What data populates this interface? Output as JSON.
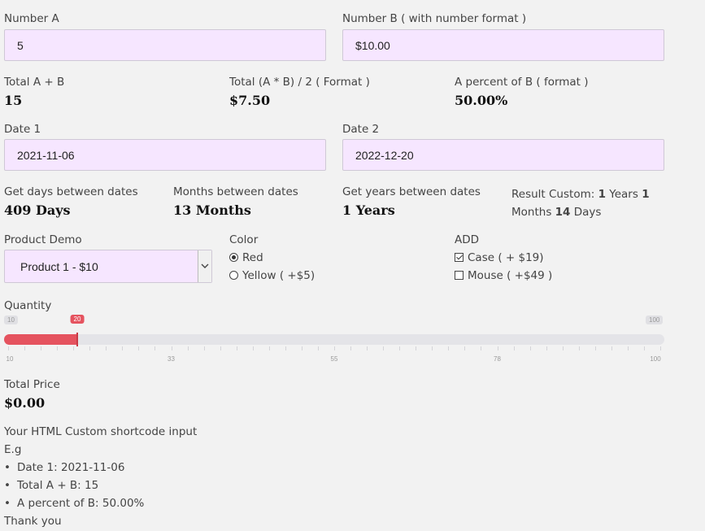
{
  "number_a": {
    "label": "Number A",
    "value": "5"
  },
  "number_b": {
    "label": "Number B ( with number format )",
    "value": "$10.00"
  },
  "totals": [
    {
      "label": "Total A + B",
      "value": "15"
    },
    {
      "label": "Total (A * B) / 2 ( Format )",
      "value": "$7.50"
    },
    {
      "label": "A percent of B ( format )",
      "value": "50.00%"
    }
  ],
  "date1": {
    "label": "Date 1",
    "value": "2021-11-06"
  },
  "date2": {
    "label": "Date 2",
    "value": "2022-12-20"
  },
  "date_results": [
    {
      "label": "Get days between dates",
      "value": "409 Days"
    },
    {
      "label": "Months between dates",
      "value": "13 Months"
    },
    {
      "label": "Get years between dates",
      "value": "1 Years"
    }
  ],
  "custom_result": {
    "prefix": "Result Custom: ",
    "years": "1",
    "years_word": " Years ",
    "months": "1",
    "months_word": "Months ",
    "days": "14",
    "days_word": " Days"
  },
  "product": {
    "label": "Product Demo",
    "selected": "Product 1 - $10"
  },
  "color": {
    "label": "Color",
    "options": [
      {
        "label": "Red",
        "checked": true
      },
      {
        "label": "Yellow ( +$5)",
        "checked": false
      }
    ]
  },
  "add": {
    "label": "ADD",
    "options": [
      {
        "label": "Case ( + $19)",
        "checked": true
      },
      {
        "label": "Mouse ( +$49 )",
        "checked": false
      }
    ]
  },
  "quantity": {
    "label": "Quantity",
    "min": "10",
    "max": "100",
    "value": "20",
    "value_fraction": 0.1111,
    "ticks": [
      "10",
      "33",
      "55",
      "78",
      "100"
    ]
  },
  "total_price": {
    "label": "Total Price",
    "value": "$0.00"
  },
  "shortcode": {
    "title": "Your HTML Custom shortcode input",
    "eg": "E.g",
    "items": [
      "Date 1: 2021-11-06",
      "Total A + B: 15",
      "A percent of B: 50.00%"
    ],
    "footer": "Thank you"
  },
  "colors": {
    "accent": "#e5535f",
    "field_bg": "#f6e6ff",
    "track": "#e4e4e8"
  }
}
